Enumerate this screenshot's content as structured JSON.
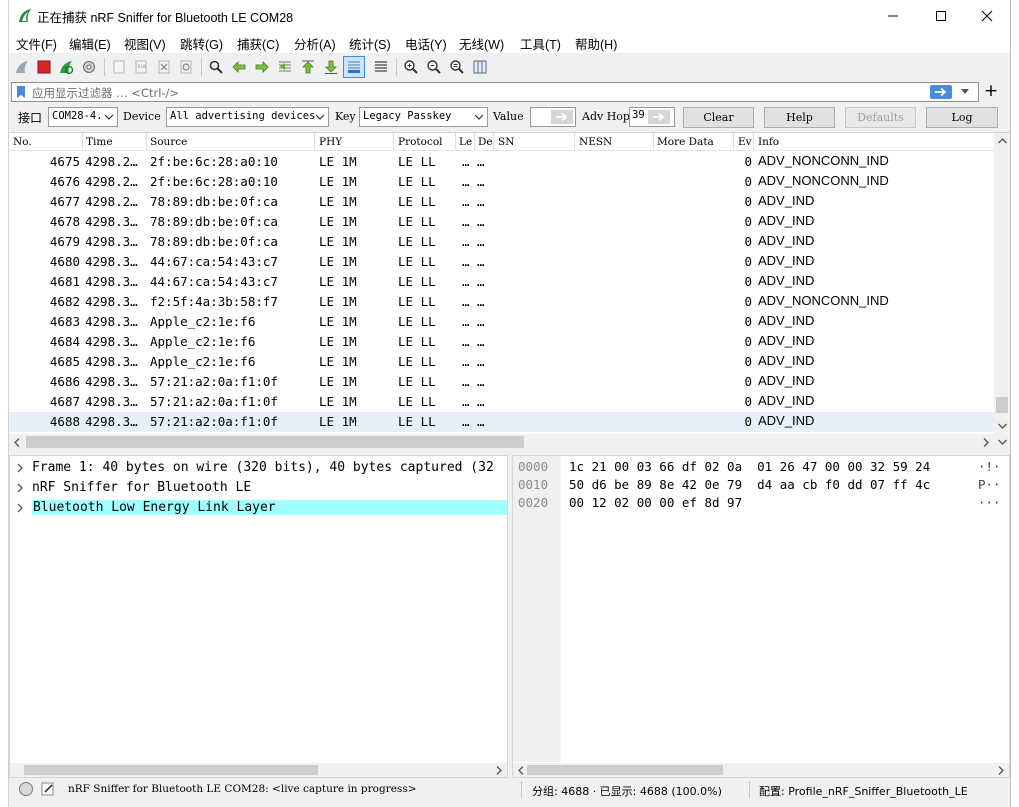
{
  "window": {
    "title": "正在捕获 nRF Sniffer for Bluetooth LE COM28"
  },
  "menu": [
    "文件(F)",
    "编辑(E)",
    "视图(V)",
    "跳转(G)",
    "捕获(C)",
    "分析(A)",
    "统计(S)",
    "电话(Y)",
    "无线(W)",
    "工具(T)",
    "帮助(H)"
  ],
  "filter": {
    "placeholder": "应用显示过滤器 … <Ctrl-/>"
  },
  "sniffer": {
    "interface_label": "接口",
    "interface_value": "COM28-4.",
    "device_label": "Device",
    "device_value": "All advertising devices",
    "key_label": "Key",
    "key_value": "Legacy Passkey",
    "value_label": "Value",
    "adv_hop_label": "Adv Hop",
    "adv_hop_value": "39",
    "clear_label": "Clear",
    "help_label": "Help",
    "defaults_label": "Defaults",
    "log_label": "Log"
  },
  "packet_list": {
    "headers": [
      "No.",
      "Time",
      "Source",
      "PHY",
      "Protocol",
      "Le",
      "De",
      "SN",
      "NESN",
      "More Data",
      "Ev",
      "Info"
    ],
    "rows": [
      {
        "no": "4675",
        "time": "4298.2…",
        "source": "2f:be:6c:28:a0:10",
        "phy": "LE 1M",
        "protocol": "LE LL",
        "le": "…",
        "de": "…",
        "ev": "0",
        "info": "ADV_NONCONN_IND"
      },
      {
        "no": "4676",
        "time": "4298.2…",
        "source": "2f:be:6c:28:a0:10",
        "phy": "LE 1M",
        "protocol": "LE LL",
        "le": "…",
        "de": "…",
        "ev": "0",
        "info": "ADV_NONCONN_IND"
      },
      {
        "no": "4677",
        "time": "4298.2…",
        "source": "78:89:db:be:0f:ca",
        "phy": "LE 1M",
        "protocol": "LE LL",
        "le": "…",
        "de": "…",
        "ev": "0",
        "info": "ADV_IND"
      },
      {
        "no": "4678",
        "time": "4298.3…",
        "source": "78:89:db:be:0f:ca",
        "phy": "LE 1M",
        "protocol": "LE LL",
        "le": "…",
        "de": "…",
        "ev": "0",
        "info": "ADV_IND"
      },
      {
        "no": "4679",
        "time": "4298.3…",
        "source": "78:89:db:be:0f:ca",
        "phy": "LE 1M",
        "protocol": "LE LL",
        "le": "…",
        "de": "…",
        "ev": "0",
        "info": "ADV_IND"
      },
      {
        "no": "4680",
        "time": "4298.3…",
        "source": "44:67:ca:54:43:c7",
        "phy": "LE 1M",
        "protocol": "LE LL",
        "le": "…",
        "de": "…",
        "ev": "0",
        "info": "ADV_IND"
      },
      {
        "no": "4681",
        "time": "4298.3…",
        "source": "44:67:ca:54:43:c7",
        "phy": "LE 1M",
        "protocol": "LE LL",
        "le": "…",
        "de": "…",
        "ev": "0",
        "info": "ADV_IND"
      },
      {
        "no": "4682",
        "time": "4298.3…",
        "source": "f2:5f:4a:3b:58:f7",
        "phy": "LE 1M",
        "protocol": "LE LL",
        "le": "…",
        "de": "…",
        "ev": "0",
        "info": "ADV_NONCONN_IND"
      },
      {
        "no": "4683",
        "time": "4298.3…",
        "source": "Apple_c2:1e:f6",
        "phy": "LE 1M",
        "protocol": "LE LL",
        "le": "…",
        "de": "…",
        "ev": "0",
        "info": "ADV_IND"
      },
      {
        "no": "4684",
        "time": "4298.3…",
        "source": "Apple_c2:1e:f6",
        "phy": "LE 1M",
        "protocol": "LE LL",
        "le": "…",
        "de": "…",
        "ev": "0",
        "info": "ADV_IND"
      },
      {
        "no": "4685",
        "time": "4298.3…",
        "source": "Apple_c2:1e:f6",
        "phy": "LE 1M",
        "protocol": "LE LL",
        "le": "…",
        "de": "…",
        "ev": "0",
        "info": "ADV_IND"
      },
      {
        "no": "4686",
        "time": "4298.3…",
        "source": "57:21:a2:0a:f1:0f",
        "phy": "LE 1M",
        "protocol": "LE LL",
        "le": "…",
        "de": "…",
        "ev": "0",
        "info": "ADV_IND"
      },
      {
        "no": "4687",
        "time": "4298.3…",
        "source": "57:21:a2:0a:f1:0f",
        "phy": "LE 1M",
        "protocol": "LE LL",
        "le": "…",
        "de": "…",
        "ev": "0",
        "info": "ADV_IND"
      },
      {
        "no": "4688",
        "time": "4298.3…",
        "source": "57:21:a2:0a:f1:0f",
        "phy": "LE 1M",
        "protocol": "LE LL",
        "le": "…",
        "de": "…",
        "ev": "0",
        "info": "ADV_IND"
      }
    ],
    "selected_row": 13
  },
  "details": {
    "tree": [
      "Frame 1: 40 bytes on wire (320 bits), 40 bytes captured (32",
      "nRF Sniffer for Bluetooth LE",
      "Bluetooth Low Energy Link Layer"
    ],
    "highlighted": 2
  },
  "bytes": {
    "rows": [
      {
        "offset": "0000",
        "hex": "1c 21 00 03 66 df 02 0a  01 26 47 00 00 32 59 24",
        "ascii": "·!·"
      },
      {
        "offset": "0010",
        "hex": "50 d6 be 89 8e 42 0e 79  d4 aa cb f0 dd 07 ff 4c",
        "ascii": "P··"
      },
      {
        "offset": "0020",
        "hex": "00 12 02 00 00 ef 8d 97",
        "ascii": "···"
      }
    ]
  },
  "status": {
    "capture": "nRF Sniffer for Bluetooth LE COM28: <live capture in progress>",
    "packets": "分组: 4688 · 已显示: 4688 (100.0%)",
    "profile": "配置: Profile_nRF_Sniffer_Bluetooth_LE"
  },
  "colors": {
    "selected_row": "#e5f0fb",
    "highlight": "#a0ffff",
    "accent": "#4a8bdb"
  }
}
